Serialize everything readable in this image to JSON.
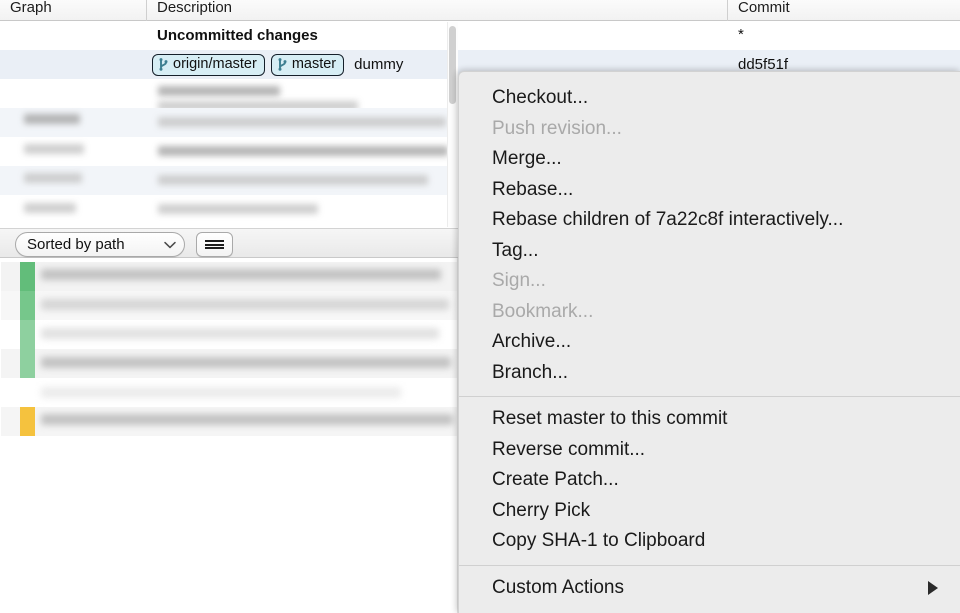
{
  "columns": {
    "graph": "Graph",
    "description": "Description",
    "commit": "Commit"
  },
  "commit_rows": [
    {
      "description": "Uncommitted changes",
      "commit": "*",
      "bold": true,
      "badges": []
    },
    {
      "description": "dummy",
      "commit": "dd5f51f",
      "bold": false,
      "badges": [
        "origin/master",
        "master"
      ]
    }
  ],
  "toolbar": {
    "sort_label": "Sorted by path",
    "sort_icon": "chevron-down-icon",
    "list_button_icon": "hamburger-list-icon"
  },
  "context_menu": {
    "groups": [
      {
        "items": [
          {
            "label": "Checkout...",
            "disabled": false
          },
          {
            "label": "Push revision...",
            "disabled": true
          },
          {
            "label": "Merge...",
            "disabled": false
          },
          {
            "label": "Rebase...",
            "disabled": false
          },
          {
            "label": "Rebase children of 7a22c8f interactively...",
            "disabled": false
          },
          {
            "label": "Tag...",
            "disabled": false
          },
          {
            "label": "Sign...",
            "disabled": true
          },
          {
            "label": "Bookmark...",
            "disabled": true
          },
          {
            "label": "Archive...",
            "disabled": false
          },
          {
            "label": "Branch...",
            "disabled": false
          }
        ]
      },
      {
        "items": [
          {
            "label": "Reset master to this commit",
            "disabled": false
          },
          {
            "label": "Reverse commit...",
            "disabled": false
          },
          {
            "label": "Create Patch...",
            "disabled": false
          },
          {
            "label": "Cherry Pick",
            "disabled": false
          },
          {
            "label": "Copy SHA-1 to Clipboard",
            "disabled": false
          }
        ]
      },
      {
        "items": [
          {
            "label": "Custom Actions",
            "disabled": false,
            "submenu": true,
            "submenu_icon": "triangle-right-icon"
          }
        ]
      }
    ]
  },
  "colors": {
    "menu_bg": "#ececec",
    "badge_bg": "#d7eef5",
    "badge_border": "#15202b",
    "graph_node": "#3fa7c4",
    "graph_line": "#3b93ad",
    "row_selected": "#eaeff6",
    "status_added": "#6cc07e",
    "status_modified": "#f2c147"
  }
}
